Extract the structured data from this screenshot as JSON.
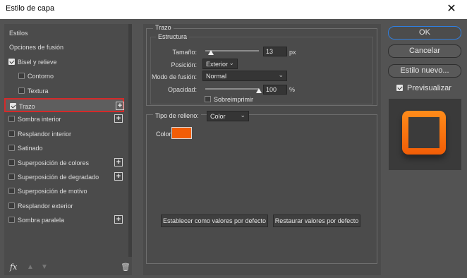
{
  "window": {
    "title": "Estilo de capa",
    "close_icon": "close-icon"
  },
  "sidebar": {
    "items": [
      {
        "label": "Estilos",
        "checkbox": false,
        "checked": false,
        "plus": false,
        "indent": false
      },
      {
        "label": "Opciones de fusión",
        "checkbox": false,
        "checked": false,
        "plus": false,
        "indent": false
      },
      {
        "label": "Bisel y relieve",
        "checkbox": true,
        "checked": true,
        "plus": false,
        "indent": false
      },
      {
        "label": "Contorno",
        "checkbox": true,
        "checked": false,
        "plus": false,
        "indent": true
      },
      {
        "label": "Textura",
        "checkbox": true,
        "checked": false,
        "plus": false,
        "indent": true
      },
      {
        "label": "Trazo",
        "checkbox": true,
        "checked": true,
        "plus": true,
        "indent": false,
        "selected": true
      },
      {
        "label": "Sombra interior",
        "checkbox": true,
        "checked": false,
        "plus": true,
        "indent": false
      },
      {
        "label": "Resplandor interior",
        "checkbox": true,
        "checked": false,
        "plus": false,
        "indent": false
      },
      {
        "label": "Satinado",
        "checkbox": true,
        "checked": false,
        "plus": false,
        "indent": false
      },
      {
        "label": "Superposición de colores",
        "checkbox": true,
        "checked": false,
        "plus": true,
        "indent": false
      },
      {
        "label": "Superposición de degradado",
        "checkbox": true,
        "checked": false,
        "plus": true,
        "indent": false
      },
      {
        "label": "Superposición de motivo",
        "checkbox": true,
        "checked": false,
        "plus": false,
        "indent": false
      },
      {
        "label": "Resplandor exterior",
        "checkbox": true,
        "checked": false,
        "plus": false,
        "indent": false
      },
      {
        "label": "Sombra paralela",
        "checkbox": true,
        "checked": false,
        "plus": true,
        "indent": false
      }
    ],
    "bottom": {
      "fx": "fx",
      "trash_icon": "trash-icon"
    }
  },
  "stroke": {
    "section_title": "Trazo",
    "structure_title": "Estructura",
    "size_label": "Tamaño:",
    "size_value": "13",
    "size_unit": "px",
    "size_fraction": 0.1,
    "position_label": "Posición:",
    "position_value": "Exterior",
    "blend_label": "Modo de fusión:",
    "blend_value": "Normal",
    "opacity_label": "Opacidad:",
    "opacity_value": "100",
    "opacity_unit": "%",
    "opacity_fraction": 1.0,
    "overprint_label": "Sobreimprimir",
    "fill_type_label": "Tipo de relleno:",
    "fill_type_value": "Color",
    "color_label": "Color:",
    "color_value": "#f25d06"
  },
  "buttons": {
    "make_default": "Establecer como valores por defecto",
    "reset_default": "Restaurar valores por defecto",
    "ok": "OK",
    "cancel": "Cancelar",
    "new_style": "Estilo nuevo...",
    "preview": "Previsualizar"
  },
  "colors": {
    "accent": "#2f7fe0",
    "selection_border": "#d42a2a",
    "stroke_orange": "#f25d06"
  }
}
